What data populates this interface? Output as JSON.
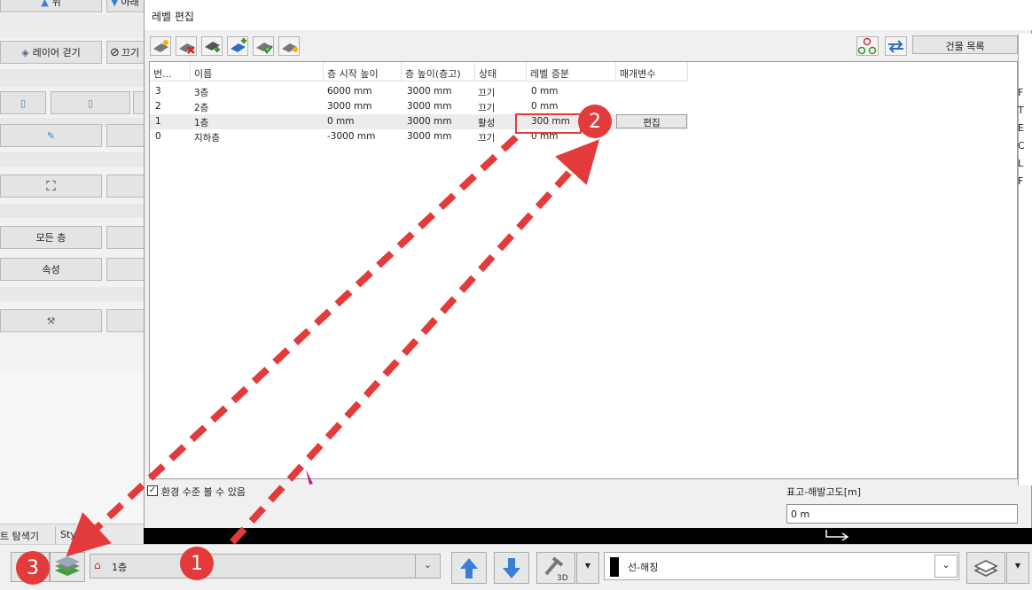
{
  "left_panel": {
    "top_btn_1": "위",
    "top_btn_2": "아래",
    "layer_walk": "레이어 걷기",
    "off_btn": "끄기",
    "all_floors": "모든 층",
    "properties": "속성",
    "tab_explorer": "트 탐색기",
    "tab_style": "Sty"
  },
  "dialog": {
    "title": "레벨 편집",
    "building_list": "건물 목록",
    "columns": [
      "번...",
      "이름",
      "층 시작 높이",
      "층 높이(층고)",
      "상태",
      "레벨 증분",
      "매개변수"
    ],
    "rows": [
      {
        "num": "3",
        "name": "3층",
        "start": "6000 mm",
        "height": "3000 mm",
        "state": "끄기",
        "inc": "0 mm"
      },
      {
        "num": "2",
        "name": "2층",
        "start": "3000 mm",
        "height": "3000 mm",
        "state": "끄기",
        "inc": "0 mm"
      },
      {
        "num": "1",
        "name": "1층",
        "start": "0 mm",
        "height": "3000 mm",
        "state": "활성",
        "inc": "300 mm"
      },
      {
        "num": "0",
        "name": "지하층",
        "start": "-3000 mm",
        "height": "3000 mm",
        "state": "끄기",
        "inc": "0 mm"
      }
    ],
    "edit_button": "편집",
    "env_checkbox": "환경 수준 볼 수 있음",
    "elevation_label": "표고-해발고도[m]",
    "elevation_value": "0 m",
    "right_letters": [
      "F",
      "T",
      "E",
      "C",
      "L",
      "F"
    ]
  },
  "bottom_bar": {
    "floor_select": "1층",
    "line_style": "선-해칭"
  },
  "annotations": {
    "badge1": "1",
    "badge2": "2",
    "badge3": "3"
  },
  "colors": {
    "annotation_red": "#e33b3b",
    "arrow_blue": "#3a7fd5"
  }
}
